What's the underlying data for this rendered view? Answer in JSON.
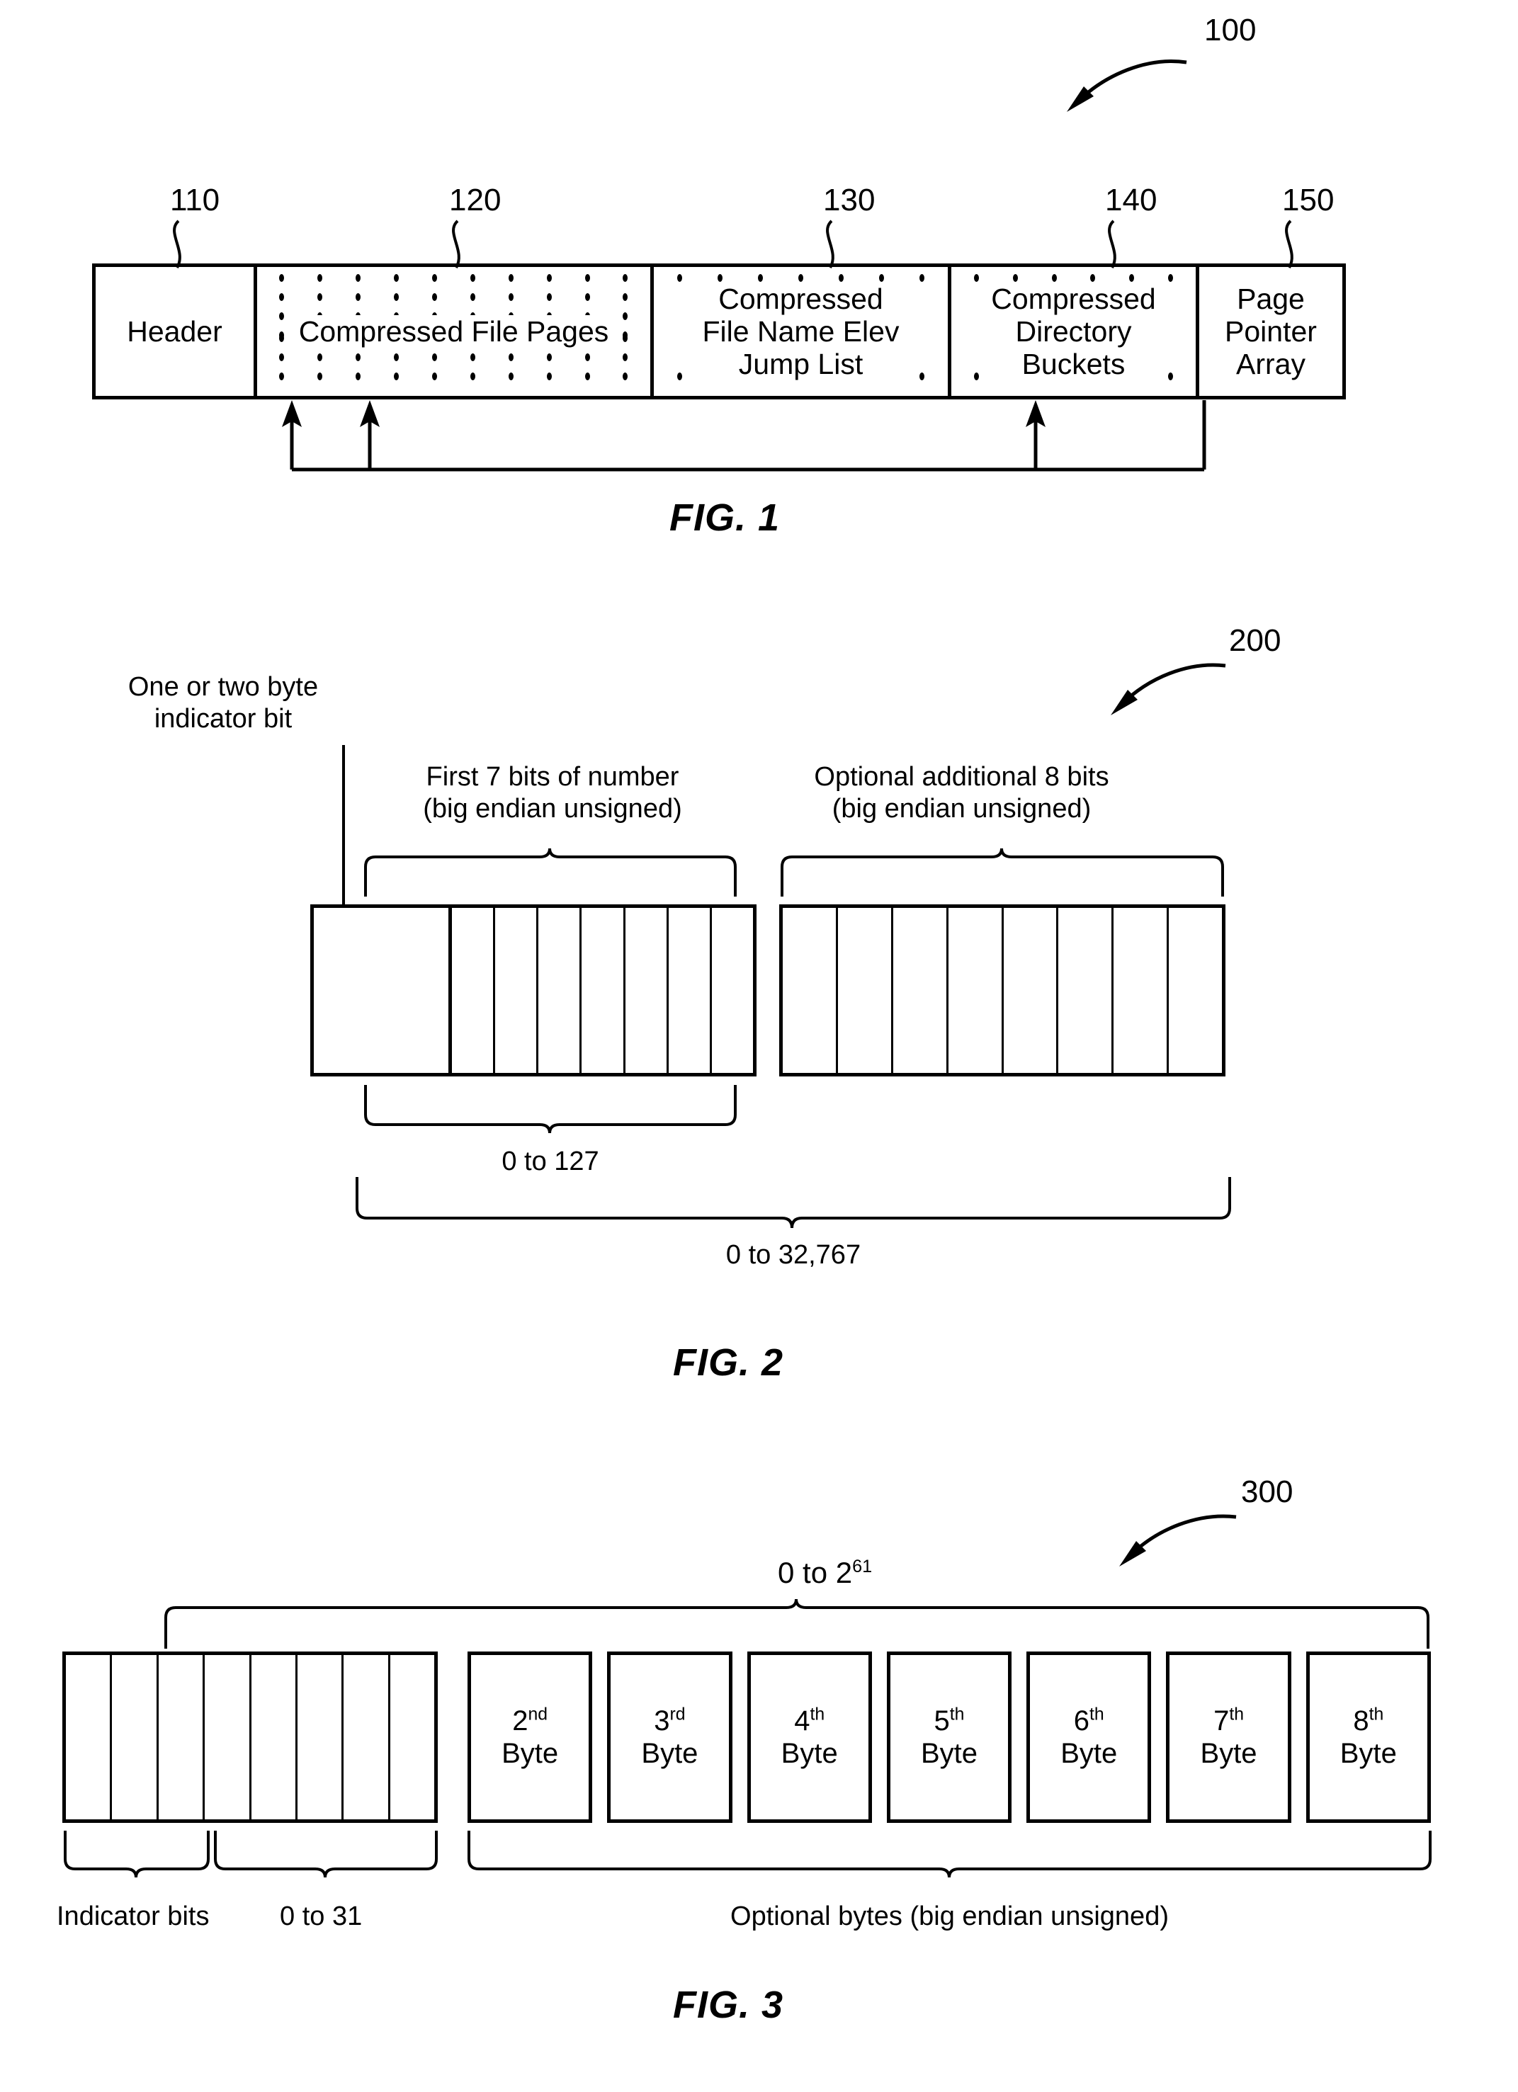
{
  "figures": [
    {
      "id": "fig1",
      "caption": "FIG. 1",
      "ref_number": "100",
      "callouts": [
        "110",
        "120",
        "130",
        "140",
        "150"
      ],
      "segments": [
        {
          "ref": "110",
          "label": "Header",
          "dotted": false
        },
        {
          "ref": "120",
          "label": "Compressed File Pages",
          "dotted": true
        },
        {
          "ref": "130",
          "label": "Compressed\nFile Name Elev\nJump List",
          "dotted": true
        },
        {
          "ref": "140",
          "label": "Compressed\nDirectory\nBuckets",
          "dotted": true
        },
        {
          "ref": "150",
          "label": "Page\nPointer\nArray",
          "dotted": false
        }
      ]
    },
    {
      "id": "fig2",
      "caption": "FIG. 2",
      "ref_number": "200",
      "labels": {
        "indicator": "One or two byte\nindicator bit",
        "first7": "First 7 bits of number\n(big endian unsigned)",
        "optional8": "Optional additional 8 bits\n(big endian unsigned)",
        "range_small": "0 to 127",
        "range_large": "0 to 32,767"
      },
      "cell_counts": {
        "indicator": 1,
        "first7": 7,
        "optional8": 8
      }
    },
    {
      "id": "fig3",
      "caption": "FIG. 3",
      "ref_number": "300",
      "labels": {
        "top_range": "0 to 2",
        "top_range_exponent": "61",
        "indicator_bits": "Indicator bits",
        "range_small": "0 to 31",
        "optional_bytes": "Optional bytes (big endian unsigned)"
      },
      "cell_counts": {
        "indicator_bits": 3,
        "value_bits": 5
      },
      "bytes": [
        {
          "ordinal": "2",
          "suffix": "nd",
          "word": "Byte"
        },
        {
          "ordinal": "3",
          "suffix": "rd",
          "word": "Byte"
        },
        {
          "ordinal": "4",
          "suffix": "th",
          "word": "Byte"
        },
        {
          "ordinal": "5",
          "suffix": "th",
          "word": "Byte"
        },
        {
          "ordinal": "6",
          "suffix": "th",
          "word": "Byte"
        },
        {
          "ordinal": "7",
          "suffix": "th",
          "word": "Byte"
        },
        {
          "ordinal": "8",
          "suffix": "th",
          "word": "Byte"
        }
      ]
    }
  ],
  "fig1": {
    "caption": "FIG. 1",
    "ref_number": "100",
    "ref_110": "110",
    "ref_120": "120",
    "ref_130": "130",
    "ref_140": "140",
    "ref_150": "150",
    "seg_header": "Header",
    "seg_pages": "Compressed File Pages",
    "seg_jump_l1": "Compressed",
    "seg_jump_l2": "File Name Elev",
    "seg_jump_l3": "Jump List",
    "seg_dir_l1": "Compressed",
    "seg_dir_l2": "Directory",
    "seg_dir_l3": "Buckets",
    "seg_ptr_l1": "Page",
    "seg_ptr_l2": "Pointer",
    "seg_ptr_l3": "Array"
  },
  "fig2": {
    "caption": "FIG. 2",
    "ref_number": "200",
    "indicator_l1": "One or two byte",
    "indicator_l2": "indicator bit",
    "first7_l1": "First 7 bits of number",
    "first7_l2": "(big endian unsigned)",
    "optional8_l1": "Optional additional 8 bits",
    "optional8_l2": "(big endian unsigned)",
    "range_small": "0 to 127",
    "range_large": "0 to 32,767"
  },
  "fig3": {
    "caption": "FIG. 3",
    "ref_number": "300",
    "top_range_base": "0 to 2",
    "top_range_exp": "61",
    "indicator_bits": "Indicator bits",
    "range_small": "0 to 31",
    "optional_bytes": "Optional bytes (big endian unsigned)",
    "byte2_num": "2",
    "byte2_sfx": "nd",
    "byte2_word": "Byte",
    "byte3_num": "3",
    "byte3_sfx": "rd",
    "byte3_word": "Byte",
    "byte4_num": "4",
    "byte4_sfx": "th",
    "byte4_word": "Byte",
    "byte5_num": "5",
    "byte5_sfx": "th",
    "byte5_word": "Byte",
    "byte6_num": "6",
    "byte6_sfx": "th",
    "byte6_word": "Byte",
    "byte7_num": "7",
    "byte7_sfx": "th",
    "byte7_word": "Byte",
    "byte8_num": "8",
    "byte8_sfx": "th",
    "byte8_word": "Byte"
  },
  "colors": {
    "ink": "#000000",
    "paper": "#ffffff"
  }
}
